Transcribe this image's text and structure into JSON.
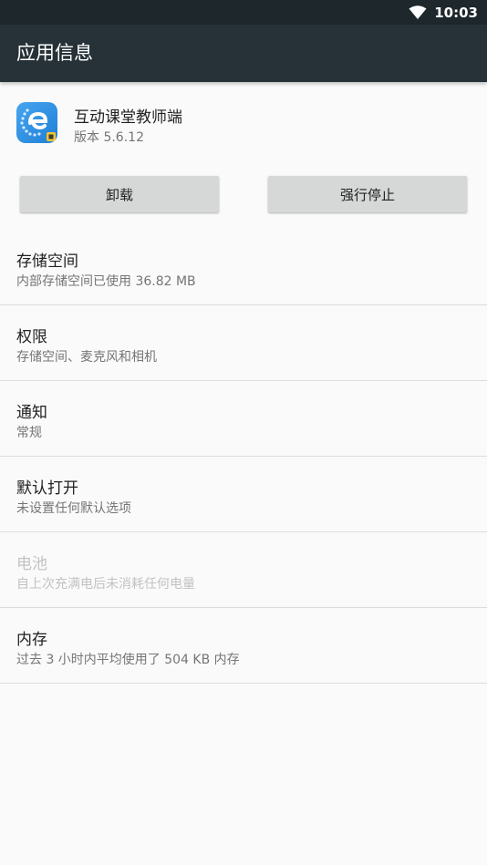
{
  "status_bar": {
    "time": "10:03",
    "icons": [
      "wifi-icon"
    ]
  },
  "app_bar": {
    "title": "应用信息"
  },
  "app": {
    "name": "互动课堂教师端",
    "version": "版本 5.6.12",
    "icon": "app-icon"
  },
  "buttons": {
    "uninstall": "卸载",
    "force_stop": "强行停止"
  },
  "settings": [
    {
      "title": "存储空间",
      "summary": "内部存储空间已使用 36.82 MB",
      "enabled": true
    },
    {
      "title": "权限",
      "summary": "存储空间、麦克风和相机",
      "enabled": true
    },
    {
      "title": "通知",
      "summary": "常规",
      "enabled": true
    },
    {
      "title": "默认打开",
      "summary": "未设置任何默认选项",
      "enabled": true
    },
    {
      "title": "电池",
      "summary": "自上次充满电后未消耗任何电量",
      "enabled": false
    },
    {
      "title": "内存",
      "summary": "过去 3 小时内平均使用了 504 KB 内存",
      "enabled": true
    }
  ],
  "colors": {
    "app_bar": "#263238",
    "status_bar": "#1e282c",
    "background": "#fafafa",
    "button": "#d6d7d7",
    "disabled_text": "#c2c2c2"
  }
}
